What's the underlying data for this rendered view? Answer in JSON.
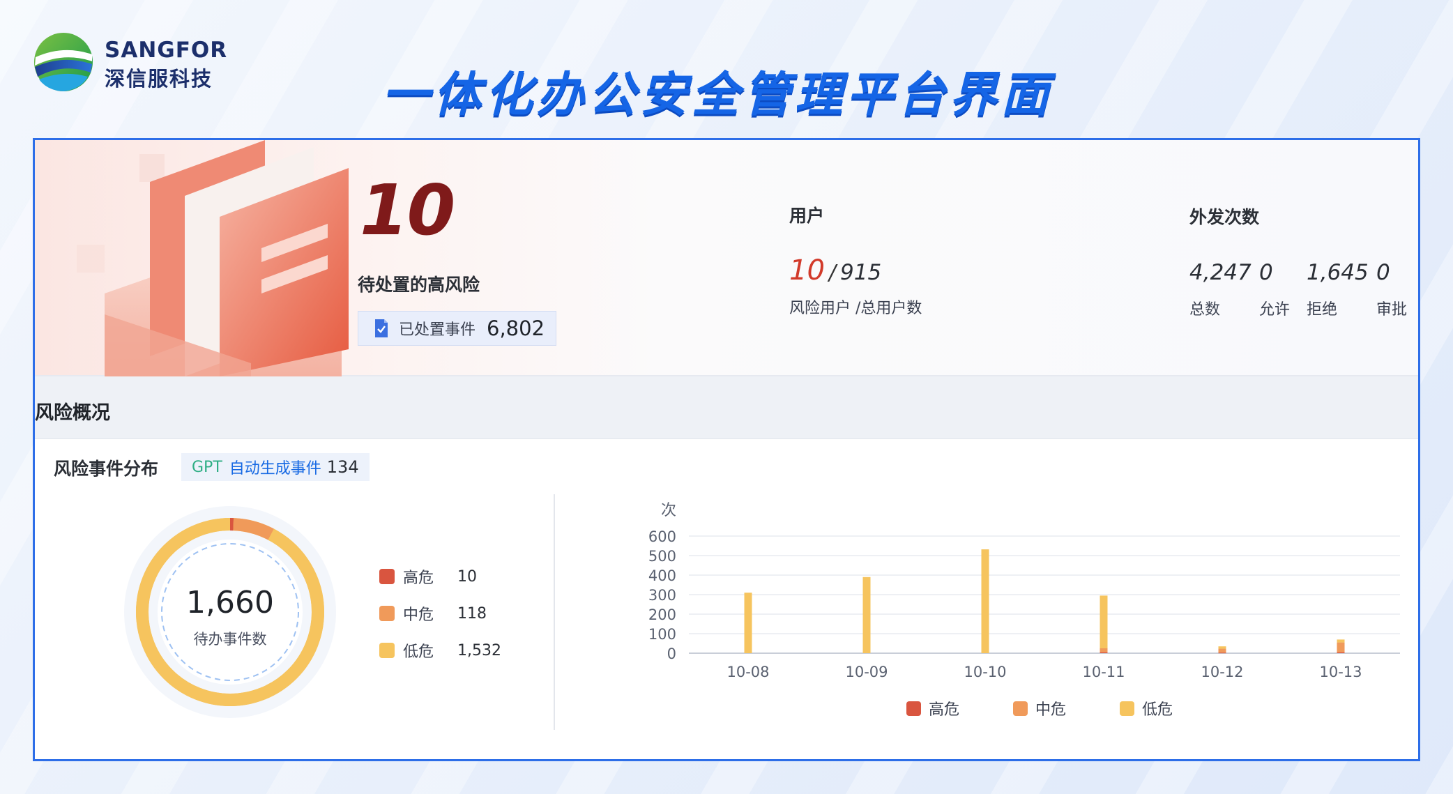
{
  "logo": {
    "en": "SANGFOR",
    "cn": "深信服科技"
  },
  "title": "一体化办公安全管理平台界面",
  "summary": {
    "pending_high_risk": "10",
    "pending_high_risk_label": "待处置的高风险",
    "handled_label": "已处置事件",
    "handled_value": "6,802"
  },
  "users": {
    "title": "用户",
    "risk_users": "10",
    "separator": "/",
    "total_users": "915",
    "subtitle": "风险用户 /总用户数"
  },
  "outbound": {
    "title": "外发次数",
    "items": [
      {
        "value": "4,247",
        "label": "总数"
      },
      {
        "value": "0",
        "label": "允许"
      },
      {
        "value": "1,645",
        "label": "拒绝"
      },
      {
        "value": "0",
        "label": "审批"
      }
    ]
  },
  "risk_overview": {
    "section_title": "风险概况",
    "distribution_title": "风险事件分布",
    "gpt_tag": {
      "prefix": "GPT",
      "text": "自动生成事件",
      "count": "134"
    },
    "donut": {
      "value": "1,660",
      "label": "待办事件数"
    },
    "levels": [
      {
        "name": "高危",
        "value": "10",
        "color": "#d9553f"
      },
      {
        "name": "中危",
        "value": "118",
        "color": "#f09a5a"
      },
      {
        "name": "低危",
        "value": "1,532",
        "color": "#f6c45e"
      }
    ]
  },
  "colors": {
    "accent": "#2d6ee8",
    "title": "#1565e6",
    "risk_red": "#d23a2a"
  },
  "chart_data": {
    "type": "bar",
    "ylabel": "次",
    "categories": [
      "10-08",
      "10-09",
      "10-10",
      "10-11",
      "10-12",
      "10-13"
    ],
    "ylim": [
      0,
      600
    ],
    "yticks": [
      0,
      100,
      200,
      300,
      400,
      500,
      600
    ],
    "stacked": true,
    "series": [
      {
        "name": "高危",
        "color": "#d9553f",
        "values": [
          0,
          0,
          0,
          5,
          3,
          5
        ]
      },
      {
        "name": "中危",
        "color": "#f09a5a",
        "values": [
          0,
          0,
          0,
          20,
          20,
          50
        ]
      },
      {
        "name": "低危",
        "color": "#f6c45e",
        "values": [
          310,
          390,
          532,
          270,
          12,
          15
        ]
      }
    ],
    "legend": "bottom-center",
    "grid": true
  }
}
